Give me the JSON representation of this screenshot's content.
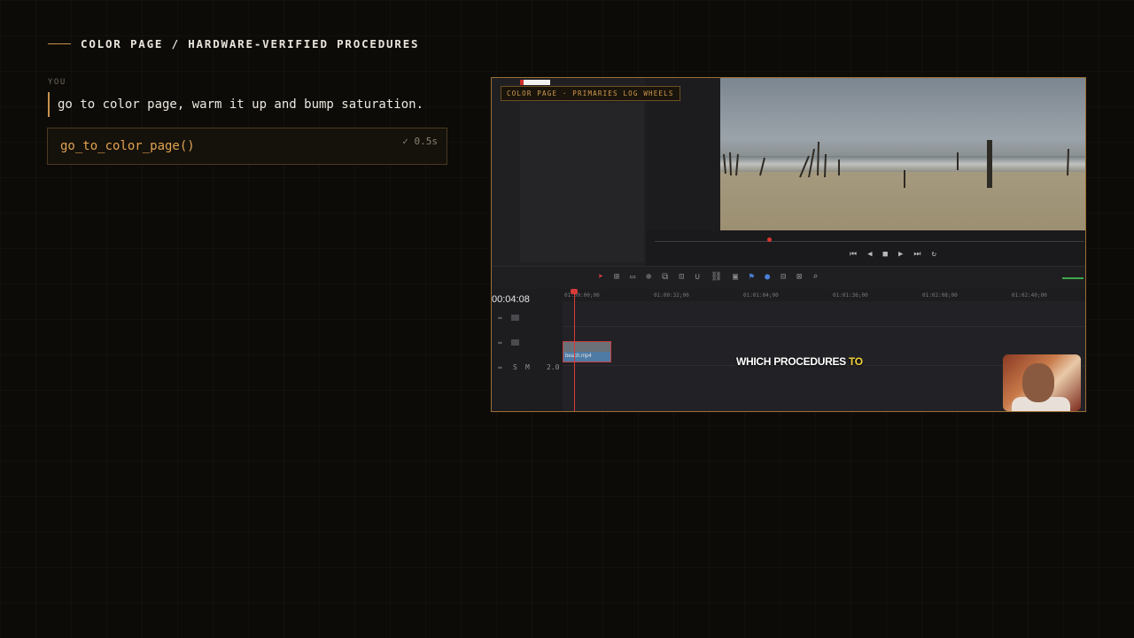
{
  "header": {
    "title": "COLOR PAGE / HARDWARE-VERIFIED PROCEDURES"
  },
  "conversation": {
    "speaker_label": "YOU",
    "user_message": "go to color page, warm it up and bump saturation.",
    "tool_call": {
      "name": "go_to_color_page()",
      "status": "✓ 0.5s"
    }
  },
  "screenshot": {
    "tag": "COLOR PAGE · PRIMARIES LOG WHEELS",
    "timecode": "00:04:08",
    "ruler_ticks": [
      "01:00:00;00",
      "01:00:32;00",
      "01:01:04;00",
      "01:01:36;00",
      "01:02:08;00",
      "01:02:40;00"
    ],
    "clip_name": "beach.mp4",
    "caption_main": "WHICH PROCEDURES",
    "caption_highlight": "TO",
    "caption_highlight_color": "#f2d23a",
    "track_label_solo": "S",
    "track_label_mute": "M",
    "track_level": "2.0"
  },
  "colors": {
    "accent": "#c9914a",
    "call_text": "#e1a452",
    "background": "#0d0b08"
  }
}
